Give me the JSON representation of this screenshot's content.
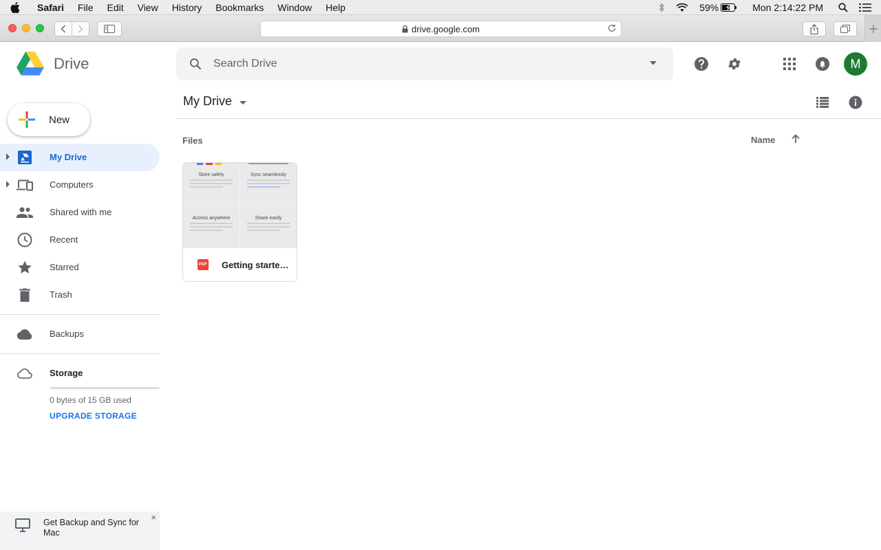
{
  "menubar": {
    "app": "Safari",
    "items": [
      "File",
      "Edit",
      "View",
      "History",
      "Bookmarks",
      "Window",
      "Help"
    ],
    "battery": "59%",
    "clock": "Mon 2:14:22 PM"
  },
  "browser": {
    "url": "drive.google.com"
  },
  "header": {
    "logo_text": "Drive",
    "search_placeholder": "Search Drive",
    "avatar_letter": "M",
    "avatar_color": "#1e7a33"
  },
  "sidebar": {
    "new_label": "New",
    "items": [
      {
        "label": "My Drive",
        "icon": "drive-icon",
        "active": true
      },
      {
        "label": "Computers",
        "icon": "computers-icon"
      },
      {
        "label": "Shared with me",
        "icon": "people-icon"
      },
      {
        "label": "Recent",
        "icon": "clock-icon"
      },
      {
        "label": "Starred",
        "icon": "star-icon"
      },
      {
        "label": "Trash",
        "icon": "trash-icon"
      }
    ],
    "backups_label": "Backups",
    "storage_label": "Storage",
    "storage_used": "0 bytes of 15 GB used",
    "storage_fraction": 0,
    "upgrade_label": "UPGRADE STORAGE",
    "promo_text": "Get Backup and Sync for Mac",
    "promo_close": "×"
  },
  "main": {
    "title": "My Drive",
    "section_label": "Files",
    "sort_label": "Name",
    "files": [
      {
        "name": "Getting started…",
        "type_badge": "PDF",
        "thumb": [
          {
            "title": "Store safely",
            "text": "Add any file you want to keep safe with the button: photos, documents, and everything else."
          },
          {
            "title": "Sync seamlessly",
            "text": "Get files from your Mac or PC into Drive using the desktop app. Download it at google.com/drive"
          },
          {
            "title": "Access anywhere",
            "text": "Every file in Drive becomes available on all your other devices – automatically."
          },
          {
            "title": "Share easily",
            "text": "Give others access to any file or folder with the button. Files are kept private by default."
          }
        ]
      }
    ]
  },
  "colors": {
    "accent": "#1a73e8",
    "active_bg": "#e8f0fe",
    "active_text": "#1967d2"
  }
}
